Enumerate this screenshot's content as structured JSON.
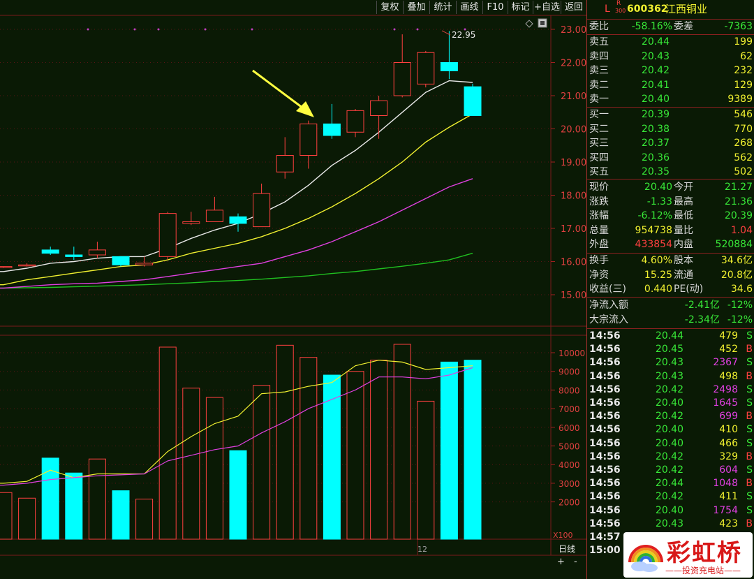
{
  "toolbar": {
    "buttons": [
      "复权",
      "叠加",
      "统计",
      "画线",
      "F10",
      "标记",
      "+自选",
      "返回"
    ]
  },
  "price_axis": [
    "23.00",
    "22.00",
    "21.00",
    "20.00",
    "19.00",
    "18.00",
    "17.00",
    "16.00",
    "15.00"
  ],
  "volume_axis": [
    "10000",
    "9000",
    "8000",
    "7000",
    "6000",
    "5000",
    "4000",
    "3000",
    "2000"
  ],
  "volume_unit": "X100",
  "period_label": "日线",
  "date_marker": "12",
  "high_annotation": "22.95",
  "zoom": {
    "plus": "+",
    "minus": "-"
  },
  "stock": {
    "market_flag": "L",
    "r_badge": "R",
    "r_badge_num": "300",
    "code": "600362",
    "name": "江西铜业"
  },
  "ratio": {
    "label1": "委比",
    "value1": "-58.16%",
    "label2": "委差",
    "value2": "-7363"
  },
  "asks": [
    {
      "label": "卖五",
      "price": "20.44",
      "vol": "199"
    },
    {
      "label": "卖四",
      "price": "20.43",
      "vol": "62"
    },
    {
      "label": "卖三",
      "price": "20.42",
      "vol": "232"
    },
    {
      "label": "卖二",
      "price": "20.41",
      "vol": "129"
    },
    {
      "label": "卖一",
      "price": "20.40",
      "vol": "9389"
    }
  ],
  "bids": [
    {
      "label": "买一",
      "price": "20.39",
      "vol": "546"
    },
    {
      "label": "买二",
      "price": "20.38",
      "vol": "770"
    },
    {
      "label": "买三",
      "price": "20.37",
      "vol": "268"
    },
    {
      "label": "买四",
      "price": "20.36",
      "vol": "562"
    },
    {
      "label": "买五",
      "price": "20.35",
      "vol": "502"
    }
  ],
  "stats": [
    {
      "l1": "现价",
      "v1": "20.40",
      "c1": "g",
      "l2": "今开",
      "v2": "21.27",
      "c2": "g"
    },
    {
      "l1": "涨跌",
      "v1": "-1.33",
      "c1": "g",
      "l2": "最高",
      "v2": "21.36",
      "c2": "g"
    },
    {
      "l1": "涨幅",
      "v1": "-6.12%",
      "c1": "g",
      "l2": "最低",
      "v2": "20.39",
      "c2": "g"
    },
    {
      "l1": "总量",
      "v1": "954738",
      "c1": "y",
      "l2": "量比",
      "v2": "1.04",
      "c2": "r"
    },
    {
      "l1": "外盘",
      "v1": "433854",
      "c1": "r",
      "l2": "内盘",
      "v2": "520884",
      "c2": "g"
    }
  ],
  "info": [
    {
      "l1": "换手",
      "v1": "4.60%",
      "l2": "股本",
      "v2": "34.6亿"
    },
    {
      "l1": "净资",
      "v1": "15.25",
      "l2": "流通",
      "v2": "20.8亿"
    },
    {
      "l1": "收益(三)",
      "v1": "0.440",
      "l2": "PE(动)",
      "v2": "34.6"
    }
  ],
  "flows": [
    {
      "label": "净流入额",
      "value": "-2.41亿",
      "pct": "-12%"
    },
    {
      "label": "大宗流入",
      "value": "-2.34亿",
      "pct": "-12%"
    }
  ],
  "ticks": [
    {
      "time": "14:56",
      "price": "20.44",
      "vol": "479",
      "side": "S",
      "vc": "y"
    },
    {
      "time": "14:56",
      "price": "20.45",
      "vol": "452",
      "side": "B",
      "vc": "y"
    },
    {
      "time": "14:56",
      "price": "20.43",
      "vol": "2367",
      "side": "S",
      "vc": "m"
    },
    {
      "time": "14:56",
      "price": "20.43",
      "vol": "498",
      "side": "B",
      "vc": "y"
    },
    {
      "time": "14:56",
      "price": "20.42",
      "vol": "2498",
      "side": "S",
      "vc": "m"
    },
    {
      "time": "14:56",
      "price": "20.40",
      "vol": "1645",
      "side": "S",
      "vc": "m"
    },
    {
      "time": "14:56",
      "price": "20.42",
      "vol": "699",
      "side": "B",
      "vc": "m"
    },
    {
      "time": "14:56",
      "price": "20.40",
      "vol": "410",
      "side": "S",
      "vc": "y"
    },
    {
      "time": "14:56",
      "price": "20.40",
      "vol": "466",
      "side": "S",
      "vc": "y"
    },
    {
      "time": "14:56",
      "price": "20.42",
      "vol": "329",
      "side": "B",
      "vc": "y"
    },
    {
      "time": "14:56",
      "price": "20.42",
      "vol": "604",
      "side": "S",
      "vc": "m"
    },
    {
      "time": "14:56",
      "price": "20.44",
      "vol": "1048",
      "side": "B",
      "vc": "m"
    },
    {
      "time": "14:56",
      "price": "20.42",
      "vol": "411",
      "side": "S",
      "vc": "y"
    },
    {
      "time": "14:56",
      "price": "20.40",
      "vol": "1754",
      "side": "S",
      "vc": "m"
    },
    {
      "time": "14:56",
      "price": "20.43",
      "vol": "423",
      "side": "B",
      "vc": "y"
    },
    {
      "time": "14:57",
      "price": "",
      "vol": "",
      "side": "",
      "vc": "y"
    },
    {
      "time": "15:00",
      "price": "",
      "vol": "",
      "side": "",
      "vc": "y"
    }
  ],
  "logo": {
    "main": "彩虹桥",
    "sub": "——投资充电站——"
  },
  "colors": {
    "up": "#ff4040",
    "down": "#00ffff",
    "ma5": "#e8e8e8",
    "ma10": "#f0f030",
    "ma20": "#e040e0",
    "ma60": "#20c020",
    "arrow": "#ffff40"
  },
  "chart_data": {
    "type": "candlestick",
    "price_range": [
      14.6,
      23.4
    ],
    "volume_range": [
      0,
      11000
    ],
    "candles": [
      {
        "o": 15.85,
        "c": 15.85,
        "h": 15.85,
        "l": 15.8,
        "vol": 2500
      },
      {
        "o": 15.9,
        "c": 15.9,
        "h": 15.95,
        "l": 15.85,
        "vol": 2200
      },
      {
        "o": 16.35,
        "c": 16.25,
        "h": 16.45,
        "l": 16.2,
        "vol": 4350
      },
      {
        "o": 16.2,
        "c": 16.15,
        "h": 16.45,
        "l": 16.05,
        "vol": 3550
      },
      {
        "o": 16.2,
        "c": 16.35,
        "h": 16.6,
        "l": 16.1,
        "vol": 4300
      },
      {
        "o": 16.15,
        "c": 15.9,
        "h": 16.15,
        "l": 15.85,
        "vol": 2600
      },
      {
        "o": 15.9,
        "c": 15.95,
        "h": 16.15,
        "l": 15.85,
        "vol": 2150
      },
      {
        "o": 16.15,
        "c": 17.45,
        "h": 17.5,
        "l": 16.05,
        "vol": 10300
      },
      {
        "o": 17.15,
        "c": 17.2,
        "h": 17.5,
        "l": 17.1,
        "vol": 8100
      },
      {
        "o": 17.2,
        "c": 17.55,
        "h": 17.95,
        "l": 17.2,
        "vol": 7600
      },
      {
        "o": 17.35,
        "c": 17.15,
        "h": 17.45,
        "l": 16.9,
        "vol": 4750
      },
      {
        "o": 17.05,
        "c": 18.05,
        "h": 18.35,
        "l": 17.05,
        "vol": 8250
      },
      {
        "o": 18.7,
        "c": 19.2,
        "h": 19.75,
        "l": 18.5,
        "vol": 10400
      },
      {
        "o": 19.2,
        "c": 20.15,
        "h": 20.25,
        "l": 18.8,
        "vol": 9750
      },
      {
        "o": 20.15,
        "c": 19.8,
        "h": 20.75,
        "l": 19.7,
        "vol": 8800
      },
      {
        "o": 19.9,
        "c": 20.55,
        "h": 20.6,
        "l": 19.75,
        "vol": 9000
      },
      {
        "o": 20.4,
        "c": 20.85,
        "h": 21.0,
        "l": 19.7,
        "vol": 9600
      },
      {
        "o": 21.0,
        "c": 22.0,
        "h": 22.85,
        "l": 20.95,
        "vol": 10450
      },
      {
        "o": 21.35,
        "c": 22.3,
        "h": 22.35,
        "l": 21.25,
        "vol": 7400
      },
      {
        "o": 22.0,
        "c": 21.75,
        "h": 22.95,
        "l": 21.5,
        "vol": 9500
      },
      {
        "o": 21.27,
        "c": 20.4,
        "h": 21.36,
        "l": 20.39,
        "vol": 9600
      }
    ],
    "ma5": [
      15.7,
      15.8,
      15.95,
      16.0,
      16.1,
      16.15,
      16.15,
      16.4,
      16.7,
      16.95,
      17.15,
      17.45,
      17.8,
      18.3,
      18.9,
      19.35,
      19.9,
      20.5,
      21.1,
      21.45,
      21.4
    ],
    "ma10": [
      15.3,
      15.45,
      15.55,
      15.65,
      15.75,
      15.85,
      15.9,
      16.05,
      16.25,
      16.4,
      16.55,
      16.75,
      17.0,
      17.3,
      17.65,
      18.05,
      18.5,
      19.0,
      19.6,
      20.05,
      20.45
    ],
    "ma20": [
      15.2,
      15.25,
      15.3,
      15.33,
      15.35,
      15.4,
      15.45,
      15.55,
      15.65,
      15.75,
      15.85,
      15.95,
      16.15,
      16.35,
      16.6,
      16.9,
      17.2,
      17.55,
      17.9,
      18.25,
      18.5
    ],
    "ma60": [
      15.2,
      15.21,
      15.22,
      15.24,
      15.26,
      15.28,
      15.3,
      15.33,
      15.36,
      15.4,
      15.43,
      15.47,
      15.52,
      15.57,
      15.64,
      15.7,
      15.78,
      15.86,
      15.95,
      16.05,
      16.25
    ],
    "vol_ma5": [
      3000,
      3100,
      3700,
      3300,
      3500,
      3500,
      3500,
      4700,
      5500,
      6200,
      6600,
      7800,
      7900,
      8200,
      8400,
      9300,
      9600,
      9500,
      9100,
      9200,
      9300
    ],
    "vol_ma10": [
      2900,
      3000,
      3200,
      3300,
      3400,
      3450,
      3500,
      4200,
      4500,
      4800,
      5000,
      5700,
      6300,
      7000,
      7500,
      8000,
      8700,
      8700,
      8600,
      8800,
      9200
    ]
  }
}
